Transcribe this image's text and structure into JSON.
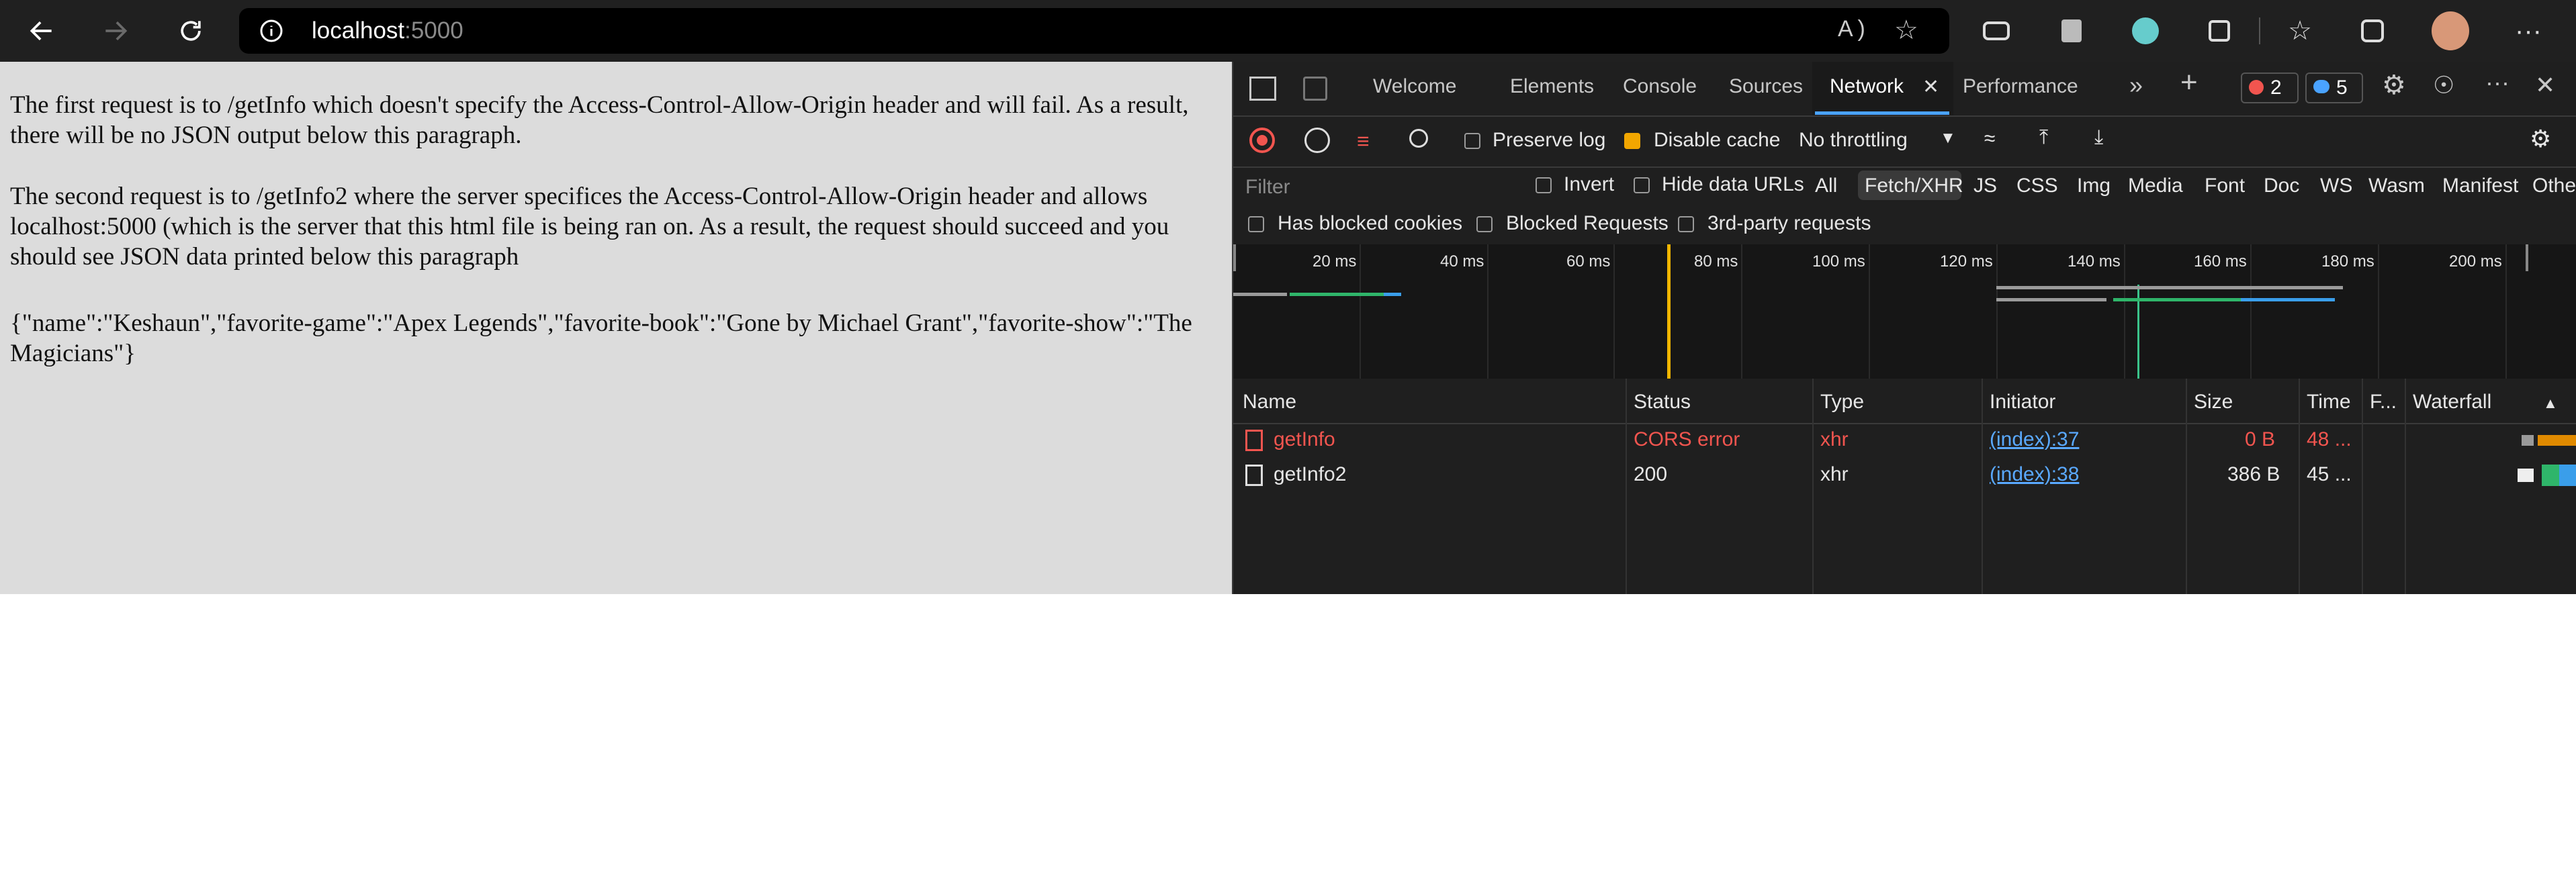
{
  "browser": {
    "address_host": "localhost",
    "address_port": ":5000"
  },
  "page": {
    "paragraph1": "The first request is to /getInfo which doesn't specify the Access-Control-Allow-Origin header and will fail. As a result, there will be no JSON output below this paragraph.",
    "paragraph2": "The second request is to /getInfo2 where the server specifices the Access-Control-Allow-Origin header and allows localhost:5000 (which is the server that this html file is being ran on. As a result, the request should succeed and you should see JSON data printed below this paragraph",
    "json_output": "{\"name\":\"Keshaun\",\"favorite-game\":\"Apex Legends\",\"favorite-book\":\"Gone by Michael Grant\",\"favorite-show\":\"The Magicians\"}"
  },
  "devtools": {
    "tabs": [
      "Welcome",
      "Elements",
      "Console",
      "Sources",
      "Network",
      "Performance"
    ],
    "error_count": "2",
    "message_count": "5",
    "toolbar": {
      "preserve_log": "Preserve log",
      "disable_cache": "Disable cache",
      "throttling": "No throttling"
    },
    "filter": {
      "placeholder": "Filter",
      "invert": "Invert",
      "hide_data_urls": "Hide data URLs",
      "types": [
        "All",
        "Fetch/XHR",
        "JS",
        "CSS",
        "Img",
        "Media",
        "Font",
        "Doc",
        "WS",
        "Wasm",
        "Manifest",
        "Other"
      ],
      "active_type": "Fetch/XHR",
      "has_blocked_cookies": "Has blocked cookies",
      "blocked_requests": "Blocked Requests",
      "third_party": "3rd-party requests"
    },
    "timeline_ticks": [
      "20 ms",
      "40 ms",
      "60 ms",
      "80 ms",
      "100 ms",
      "120 ms",
      "140 ms",
      "160 ms",
      "180 ms",
      "200 ms"
    ],
    "columns": {
      "name": "Name",
      "status": "Status",
      "type": "Type",
      "initiator": "Initiator",
      "size": "Size",
      "time": "Time",
      "fulfilled": "F...",
      "waterfall": "Waterfall"
    },
    "requests": [
      {
        "name": "getInfo",
        "status": "CORS error",
        "type": "xhr",
        "initiator": "(index):37",
        "size": "0 B",
        "time": "48 ..."
      },
      {
        "name": "getInfo2",
        "status": "200",
        "type": "xhr",
        "initiator": "(index):38",
        "size": "386 B",
        "time": "45 ..."
      }
    ],
    "colors": {
      "accent": "#4aa3ff",
      "error": "#f2554f",
      "checkbox": "#f2a600"
    }
  }
}
